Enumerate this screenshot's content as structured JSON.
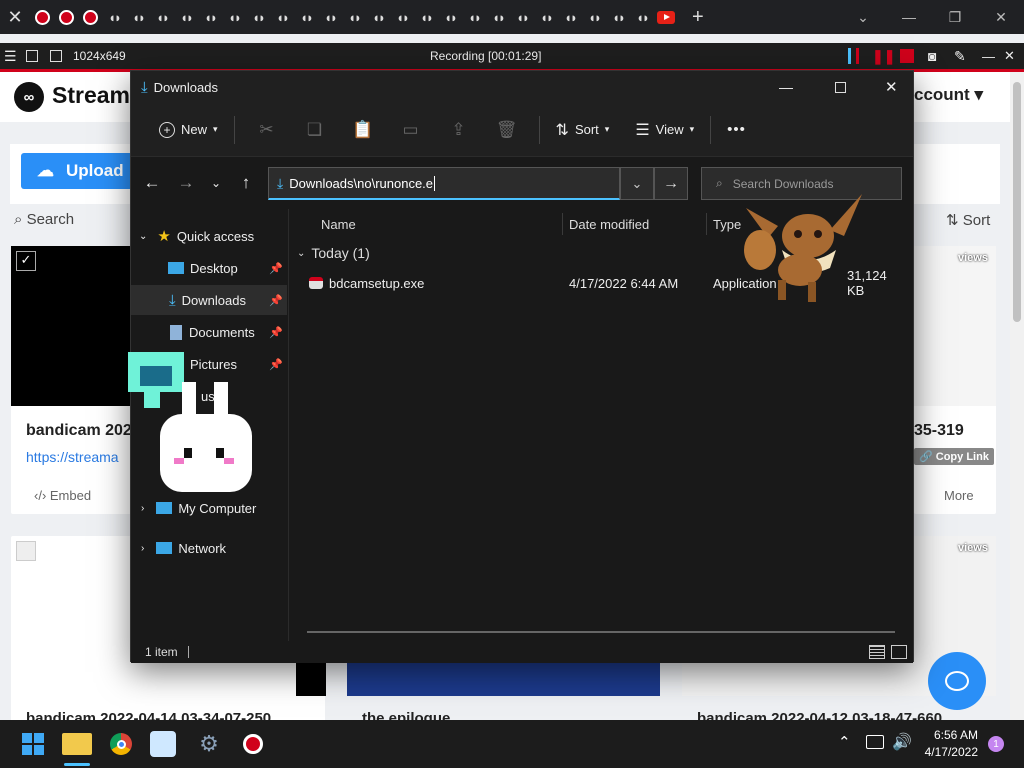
{
  "recorder": {
    "resolution": "1024x649",
    "status": "Recording [00:01:29]"
  },
  "webpage": {
    "brand": "Streama",
    "account": "ccount",
    "upload_label": "Upload",
    "search_label": "Search",
    "sort_label": "Sort",
    "card1_title": "bandicam 202",
    "card1_link": "https://streama",
    "card1_embed": "Embed",
    "card2_suffix": "35-319",
    "card2_copy": "Copy Link",
    "card2_more": "More",
    "views1": "views",
    "views2": "views",
    "bottom_title1": "bandicam 2022-04-14 03-34-07-250",
    "bottom_title2": "the epilogue",
    "bottom_title3": "bandicam 2022-04-12 03-18-47-660"
  },
  "explorer": {
    "title": "Downloads",
    "cmd": {
      "new_label": "New",
      "sort_label": "Sort",
      "view_label": "View",
      "more_label": "•••"
    },
    "address_value": "Downloads\\no\\runonce.e",
    "search_placeholder": "Search Downloads",
    "nav": {
      "quick_access": "Quick access",
      "desktop": "Desktop",
      "downloads": "Downloads",
      "documents": "Documents",
      "pictures": "Pictures",
      "partial": "us",
      "my_computer": "My Computer",
      "network": "Network"
    },
    "columns": {
      "name": "Name",
      "date": "Date modified",
      "type": "Type"
    },
    "group": "Today (1)",
    "files": [
      {
        "name": "bdcamsetup.exe",
        "date": "4/17/2022 6:44 AM",
        "type": "Application",
        "size": "31,124 KB"
      }
    ],
    "status": "1 item"
  },
  "taskbar": {
    "time": "6:56 AM",
    "date": "4/17/2022",
    "notif_count": "1"
  },
  "colors": {
    "accent": "#4cc2ff",
    "record": "#d0021b",
    "upload": "#2a8ff7"
  }
}
